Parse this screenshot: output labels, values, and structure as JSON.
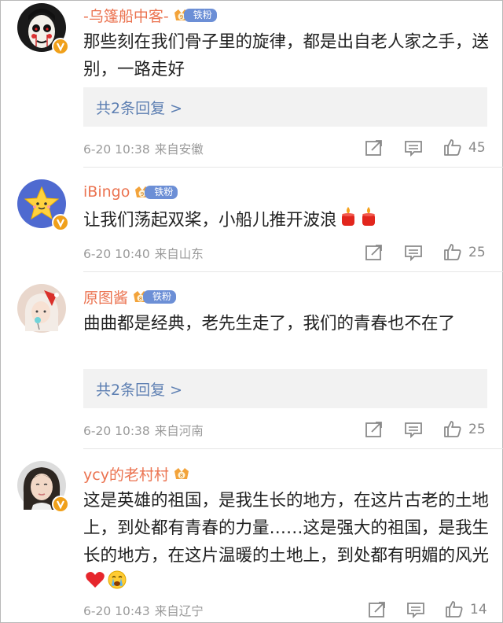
{
  "comments": [
    {
      "username": "-乌篷船中客-",
      "fan_level": "9",
      "fan_badge": "铁粉",
      "text": "那些刻在我们骨子里的旋律，都是出自老人家之手，送别，一路走好",
      "reply_label": "共2条回复 >",
      "time": "6-20 10:38",
      "source": "来自安徽",
      "likes": "45",
      "avatar_icon": "mask-avatar-icon"
    },
    {
      "username": "iBingo",
      "fan_level": "9",
      "fan_badge": "铁粉",
      "text": "让我们荡起双桨，小船儿推开波浪",
      "emojis": [
        "candle-emoji",
        "candle-emoji"
      ],
      "time": "6-20 10:40",
      "source": "来自山东",
      "likes": "25",
      "avatar_icon": "star-avatar-icon"
    },
    {
      "username": "原图酱",
      "fan_level": "8",
      "fan_badge": "铁粉",
      "text": "曲曲都是经典，老先生走了，我们的青春也不在了",
      "reply_label": "共2条回复 >",
      "time": "6-20 10:38",
      "source": "来自河南",
      "likes": "25",
      "avatar_icon": "girl-avatar-icon"
    },
    {
      "username": "ycy的老村村",
      "fan_level": "8",
      "text": "这是英雄的祖国，是我生长的地方，在这片古老的土地上，到处都有青春的力量……这是强大的祖国，是我生长的地方，在这片温暖的土地上，到处都有明媚的风光",
      "emojis": [
        "heart-emoji",
        "crying-emoji"
      ],
      "time": "6-20 10:43",
      "source": "来自辽宁",
      "likes": "14",
      "avatar_icon": "portrait-avatar-icon"
    }
  ],
  "colors": {
    "username": "#eb7350",
    "link": "#5d7fb2",
    "meta": "#9a9a9a",
    "fan_badge": "#6c8fd6",
    "verified": "#f0a01a"
  }
}
